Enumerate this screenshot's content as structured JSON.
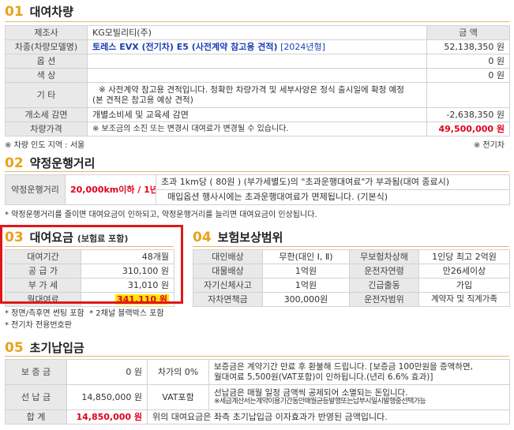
{
  "sec1": {
    "num": "01",
    "title": "대여차량",
    "header_amount": "금 액",
    "rows": {
      "maker_label": "제조사",
      "maker_value": "KG모빌리티(주)",
      "model_label": "차종(차량모델명)",
      "model_value": "토레스 EVX (전기차) E5 (사전계약 참고용 견적)",
      "model_year": "[2024년형]",
      "model_amount": "52,138,350 원",
      "option_label": "옵 션",
      "option_amount": "0 원",
      "color_label": "색 상",
      "color_amount": "0 원",
      "etc_label": "기 타",
      "etc_line1": "※ 사전계약 참고용 견적입니다. 정확한 차량가격 및 세부사양은 정식 출시일에 확정 예정",
      "etc_line2": "(본 견적은 참고용 예상 견적)",
      "tax_label": "개소세 감면",
      "tax_value": "개별소비세 및 교육세 감면",
      "tax_amount": "-2,638,350 원",
      "price_label": "차량가격",
      "price_note": "※ 보조금의 소진 또는 변경시 대여료가 변경될 수 있습니다.",
      "price_amount": "49,500,000 원"
    },
    "note_left": "※ 차량 인도 지역 : 서울",
    "note_right": "※ 전기차"
  },
  "sec2": {
    "num": "02",
    "title": "약정운행거리",
    "label": "약정운행거리",
    "value": "20,000km이하 / 1년",
    "desc1": "초과 1km당 ( 80원 ) (부가세별도)의 \"초과운행대여료\"가 부과됨(대여 종료시)",
    "desc2": "매입옵션 행사시에는 초과운행대여료가 면제됩니다. (기본식)",
    "note": "* 약정운행거리를 줄이면 대여요금이 인하되고, 약정운행거리를 늘리면 대여요금이 인상됩니다."
  },
  "sec3": {
    "num": "03",
    "title": "대여요금",
    "sub": "(보험료 포함)",
    "rows": [
      {
        "label": "대여기간",
        "value": "48개월"
      },
      {
        "label": "공 급 가",
        "value": "310,100 원"
      },
      {
        "label": "부 가 세",
        "value": "31,010 원"
      },
      {
        "label": "월대여료",
        "value": "341,110 원"
      }
    ],
    "note1": "* 정면/측후면 썬팅 포함",
    "note1b": "* 2채널 블랙박스 포함",
    "note2": "* 전기차 전용번호판"
  },
  "sec4": {
    "num": "04",
    "title": "보험보상범위",
    "rows": [
      {
        "l1": "대인배상",
        "v1": "무한(대인 Ⅰ, Ⅱ)",
        "l2": "무보험차상해",
        "v2": "1인당 최고 2억원"
      },
      {
        "l1": "대물배상",
        "v1": "1억원",
        "l2": "운전자연령",
        "v2": "만26세이상"
      },
      {
        "l1": "자기신체사고",
        "v1": "1억원",
        "l2": "긴급출동",
        "v2": "가입"
      },
      {
        "l1": "자차면책금",
        "v1": "300,000원",
        "l2": "운전자범위",
        "v2": "계약자 및 직계가족"
      }
    ]
  },
  "sec5": {
    "num": "05",
    "title": "초기납입금",
    "deposit_label": "보 증 금",
    "deposit_value": "0 원",
    "deposit_mid": "차가의 0%",
    "deposit_desc1": "보증금은 계약기간 만료 후 환불해 드립니다. [보증금 100만원을 증액하면,",
    "deposit_desc2": "월대여료 5,500원(VAT포함)이 인하됩니다.(년리 6.6% 효과)]",
    "prepay_label": "선 납 금",
    "prepay_value": "14,850,000 원",
    "prepay_mid": "VAT포함",
    "prepay_desc1": "선납금은 매월 일정 금액씩 공제되어 소멸되는 돈입니다.",
    "prepay_desc2": "※세금계산서는계약이용기간동안매월균등발행또는납부시일시발행중선택가능",
    "total_label": "합 계",
    "total_value": "14,850,000 원",
    "total_desc": "위의 대여요금은 좌측 초기납입금 이자효과가 반영된 금액입니다."
  }
}
